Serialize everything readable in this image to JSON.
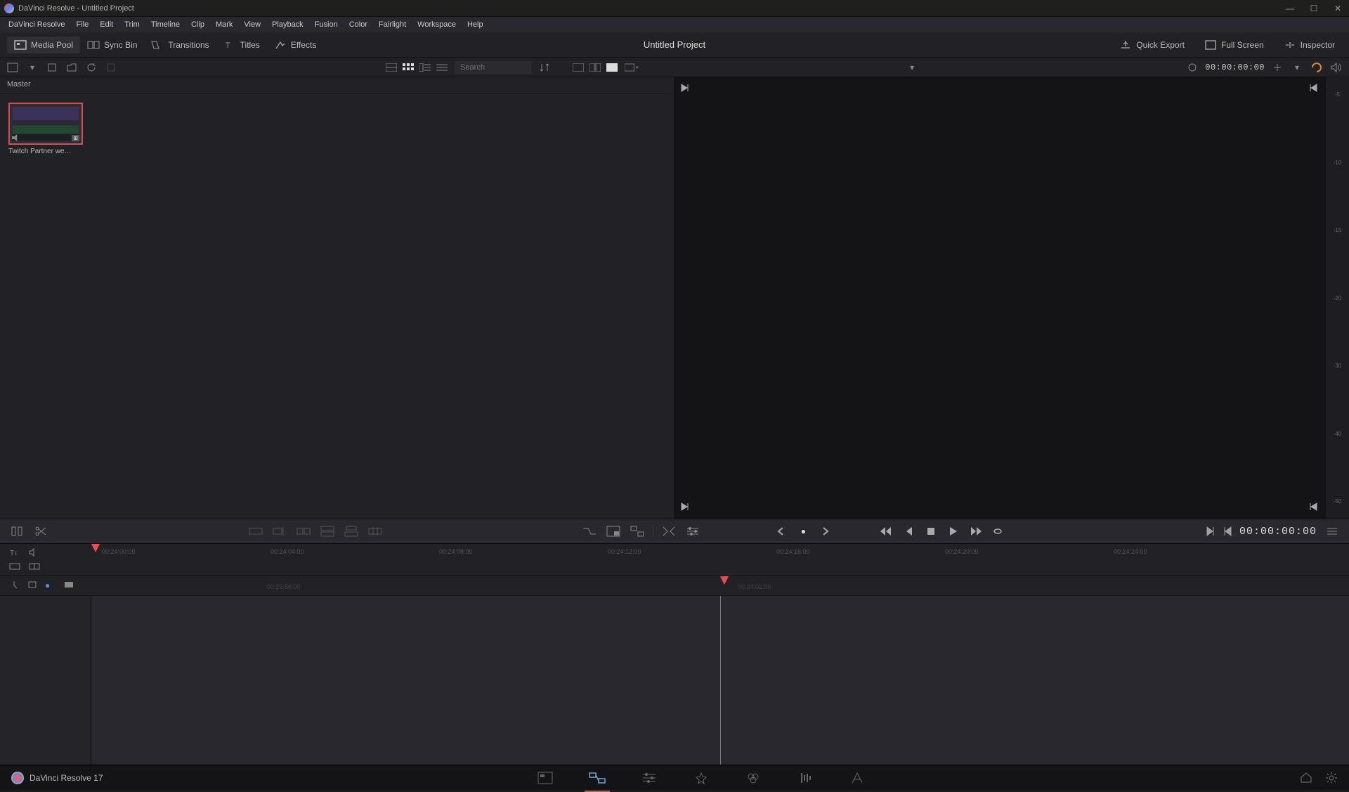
{
  "titlebar": {
    "title": "DaVinci Resolve - Untitled Project"
  },
  "menubar": [
    "DaVinci Resolve",
    "File",
    "Edit",
    "Trim",
    "Timeline",
    "Clip",
    "Mark",
    "View",
    "Playback",
    "Fusion",
    "Color",
    "Fairlight",
    "Workspace",
    "Help"
  ],
  "wsbar": {
    "media_pool": "Media Pool",
    "sync_bin": "Sync Bin",
    "transitions": "Transitions",
    "titles": "Titles",
    "effects": "Effects",
    "quick_export": "Quick Export",
    "full_screen": "Full Screen",
    "inspector": "Inspector",
    "project_title": "Untitled Project"
  },
  "subbar": {
    "search_placeholder": "Search",
    "timecode": "00:00:00:00"
  },
  "media_pool": {
    "bin": "Master",
    "clip": {
      "name": "Twitch Partner we…",
      "badge": "⊞"
    }
  },
  "meter_ticks": [
    "-5",
    "-10",
    "-15",
    "-20",
    "-30",
    "-40",
    "-50"
  ],
  "editbar": {
    "timecode": "00:00:00:00"
  },
  "ruler_ticks": [
    "00:24:00:00",
    "00:24:04:00",
    "00:24:08:00",
    "00:24:12:00",
    "00:24:16:00",
    "00:24:20:00",
    "00:24:24:00"
  ],
  "zoom_ticks": [
    "00:23:58:00",
    "00:24:02:00"
  ],
  "pagebar": {
    "label": "DaVinci Resolve 17"
  },
  "colors": {
    "accent": "#d84e4e",
    "playhead": "#e94f4f",
    "active_page": "#6fa4d6"
  }
}
